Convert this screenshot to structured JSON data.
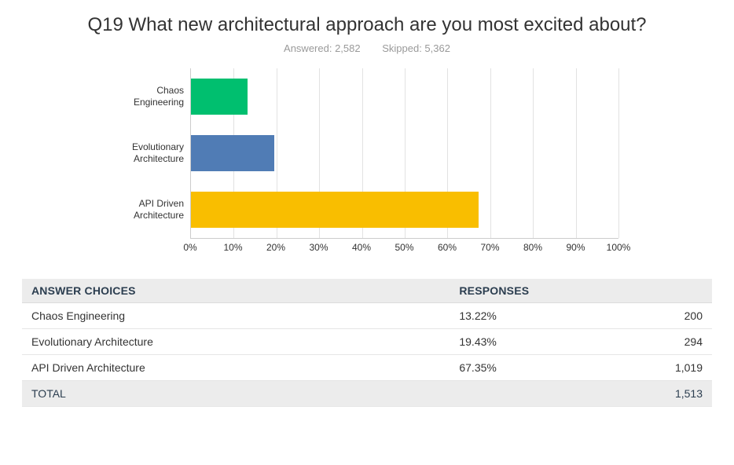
{
  "title": "Q19 What new architectural approach are you most excited about?",
  "meta": {
    "answered_label": "Answered: 2,582",
    "skipped_label": "Skipped: 5,362"
  },
  "chart_data": {
    "type": "bar",
    "orientation": "horizontal",
    "categories": [
      "Chaos Engineering",
      "Evolutionary Architecture",
      "API Driven Architecture"
    ],
    "values": [
      13.22,
      19.43,
      67.35
    ],
    "colors": [
      "#00bf6f",
      "#507cb5",
      "#f9be00"
    ],
    "xlabel": "",
    "ylabel": "",
    "xlim": [
      0,
      100
    ],
    "xticks": [
      "0%",
      "10%",
      "20%",
      "30%",
      "40%",
      "50%",
      "60%",
      "70%",
      "80%",
      "90%",
      "100%"
    ],
    "title": ""
  },
  "category_labels": {
    "c0a": "Chaos",
    "c0b": "Engineering",
    "c1a": "Evolutionary",
    "c1b": "Architecture",
    "c2a": "API Driven",
    "c2b": "Architecture"
  },
  "table": {
    "headers": {
      "choice": "ANSWER CHOICES",
      "responses": "RESPONSES"
    },
    "rows": [
      {
        "choice": "Chaos Engineering",
        "pct": "13.22%",
        "count": "200"
      },
      {
        "choice": "Evolutionary Architecture",
        "pct": "19.43%",
        "count": "294"
      },
      {
        "choice": "API Driven Architecture",
        "pct": "67.35%",
        "count": "1,019"
      }
    ],
    "total": {
      "label": "TOTAL",
      "count": "1,513"
    }
  }
}
